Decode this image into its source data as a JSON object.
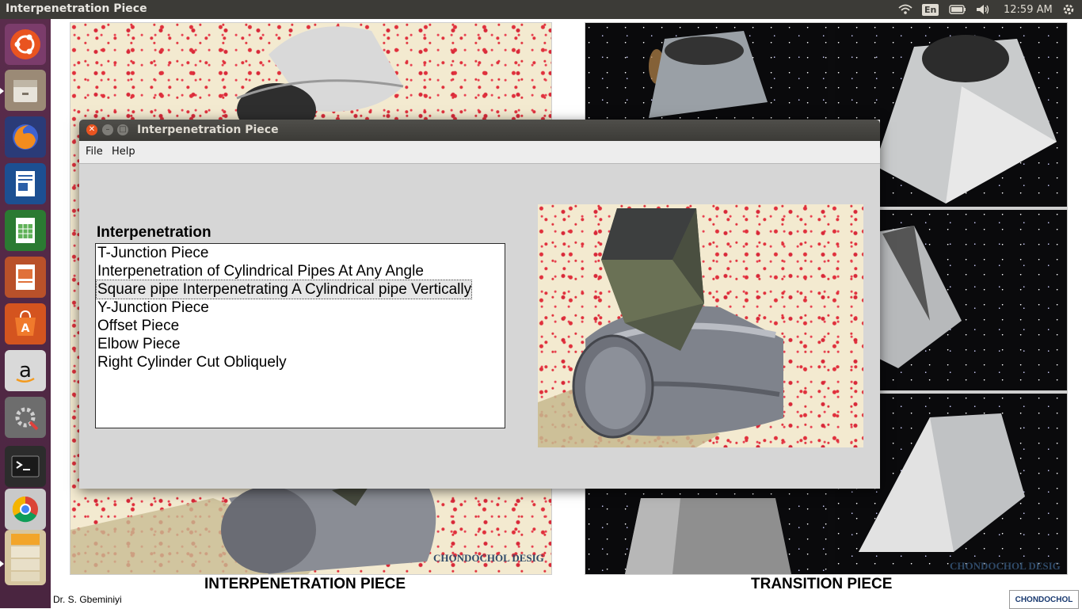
{
  "top_panel": {
    "window_title": "Interpenetration Piece",
    "language": "En",
    "clock": "12:59 AM"
  },
  "launcher": {
    "items": [
      {
        "name": "ubuntu-dash-icon"
      },
      {
        "name": "file-manager-icon"
      },
      {
        "name": "firefox-icon"
      },
      {
        "name": "libreoffice-writer-icon"
      },
      {
        "name": "libreoffice-calc-icon"
      },
      {
        "name": "libreoffice-impress-icon"
      },
      {
        "name": "software-center-icon"
      },
      {
        "name": "amazon-icon"
      },
      {
        "name": "system-settings-icon"
      },
      {
        "name": "terminal-icon"
      },
      {
        "name": "chrome-icon"
      }
    ]
  },
  "background_document": {
    "left_caption": "INTERPENETRATION PIECE",
    "right_caption": "TRANSITION PIECE",
    "author": "Dr. S. Gbeminiyi",
    "logo_text": "CHONDOCHOL",
    "watermark_left": "CHONDOCHOL DESIG",
    "watermark_right": "CHONDOCHOL DESIG"
  },
  "dialog": {
    "title": "Interpenetration Piece",
    "menu": {
      "file": "File",
      "help": "Help"
    },
    "list_heading": "Interpenetration",
    "list_items": [
      "T-Junction Piece",
      "Interpenetration of Cylindrical Pipes At Any Angle",
      "Square pipe Interpenetrating A Cylindrical pipe Vertically",
      "Y-Junction Piece",
      "Offset Piece",
      "Elbow Piece",
      "Right Cylinder Cut Obliquely"
    ],
    "selected_index": 2
  },
  "colors": {
    "panel": "#3c3b37",
    "launcher": "#4a2540",
    "accent_close": "#e95420",
    "dialog_bg": "#d6d6d6"
  }
}
